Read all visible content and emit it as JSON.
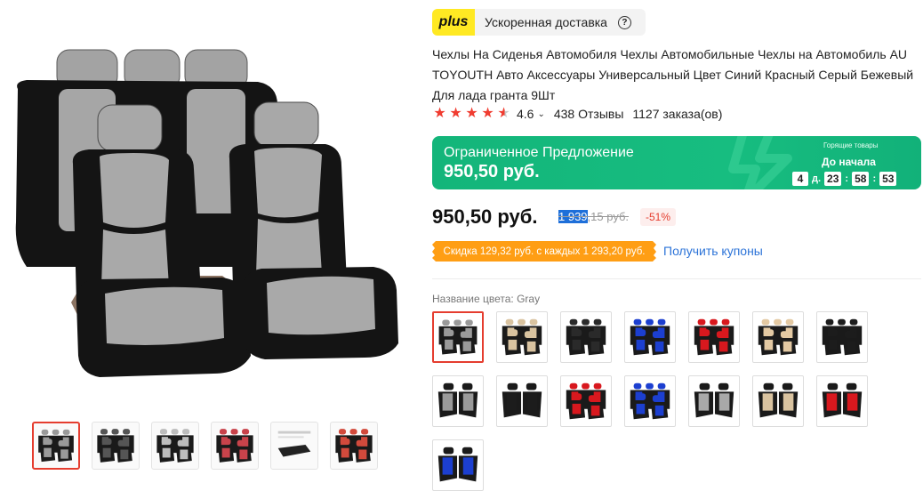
{
  "plus": {
    "logo_text": "plus",
    "delivery_text": "Ускоренная доставка",
    "help_icon": "question-circle-icon"
  },
  "product": {
    "title": "Чехлы На Сиденья Автомобиля Чехлы Автомобильные Чехлы на Автомобиль AU TOYOUTH Авто Аксессуары Универсальный Цвет Синий Красный Серый Бежевый Для лада гранта 9Шт"
  },
  "rating": {
    "stars": 4.6,
    "value": "4.6",
    "reviews": "438 Отзывы",
    "orders": "1127 заказа(ов)"
  },
  "offer": {
    "label": "Ограниченное Предложение",
    "price": "950,50 руб.",
    "countdown_title": "Горящие товары",
    "countdown_subtitle": "До начала",
    "days": "4",
    "days_unit": "д.",
    "hours": "23",
    "minutes": "58",
    "seconds": "53",
    "bg_color": "#17bd80"
  },
  "price": {
    "current": "950,50 руб.",
    "old_selected": "1 939",
    "old_rest": ",15 руб.",
    "discount": "-51%"
  },
  "coupon": {
    "text": "Скидка 129,32 руб. с каждых 1 293,20 руб.",
    "link": "Получить купоны",
    "color": "#ff9e14"
  },
  "colors": {
    "label": "Название цвета:",
    "selected_name": "Gray",
    "variants": [
      {
        "accent": "#9a9a9a",
        "style": "set"
      },
      {
        "accent": "#d9c3a0",
        "style": "set"
      },
      {
        "accent": "#2a2a2a",
        "style": "set"
      },
      {
        "accent": "#1c3fd0",
        "style": "set"
      },
      {
        "accent": "#d8181e",
        "style": "set"
      },
      {
        "accent": "#e3c9a3",
        "style": "set"
      },
      {
        "accent": "#1c1c1c",
        "style": "set"
      },
      {
        "accent": "#9a9a9a",
        "style": "pair"
      },
      {
        "accent": "#1c1c1c",
        "style": "pair"
      },
      {
        "accent": "#d8181e",
        "style": "set"
      },
      {
        "accent": "#1c3fd0",
        "style": "set"
      },
      {
        "accent": "#a9a9a9",
        "style": "pair"
      },
      {
        "accent": "#d9c3a0",
        "style": "pair"
      },
      {
        "accent": "#d8181e",
        "style": "pair"
      },
      {
        "accent": "#1c3fd0",
        "style": "pair"
      }
    ]
  },
  "thumbnails": [
    {
      "accent": "#9a9a9a"
    },
    {
      "accent": "#555555"
    },
    {
      "accent": "#bdbdbd"
    },
    {
      "accent": "#c8434b"
    },
    {
      "accent": "#222222"
    },
    {
      "accent": "#d24a3c"
    }
  ]
}
